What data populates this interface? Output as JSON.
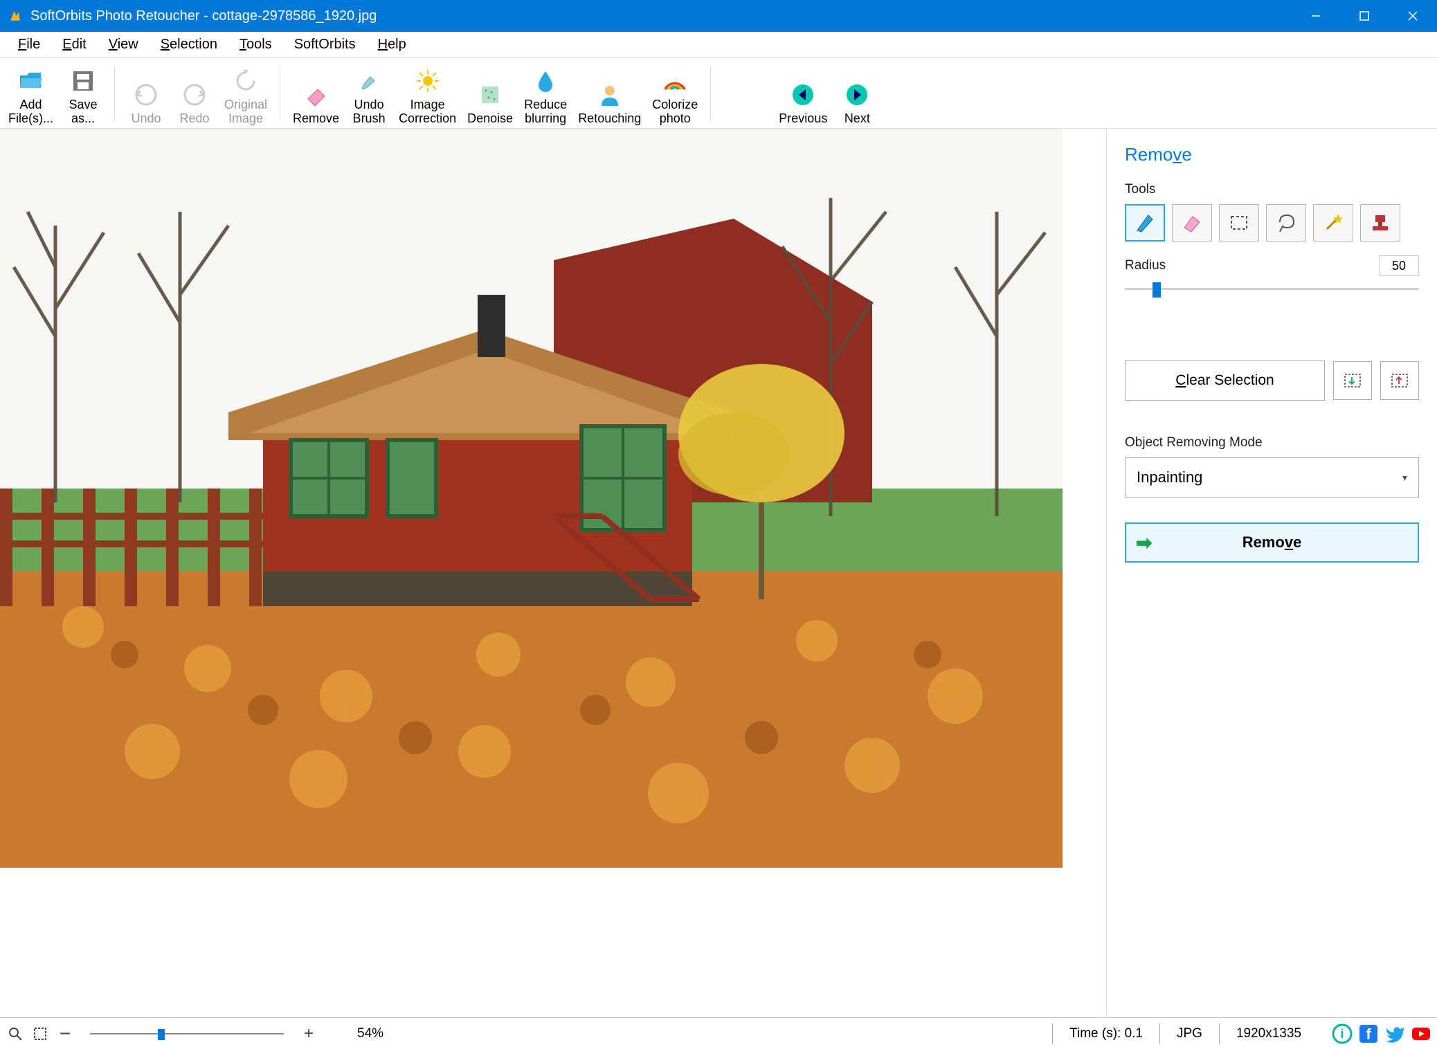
{
  "titlebar": {
    "app_name": "SoftOrbits Photo Retoucher",
    "file_name": "cottage-2978586_1920.jpg"
  },
  "menubar": [
    "File",
    "Edit",
    "View",
    "Selection",
    "Tools",
    "SoftOrbits",
    "Help"
  ],
  "toolbar": {
    "add_files": "Add File(s)...",
    "save_as": "Save as...",
    "undo": "Undo",
    "redo": "Redo",
    "original": "Original Image",
    "remove": "Remove",
    "undo_brush": "Undo Brush",
    "image_correction": "Image Correction",
    "denoise": "Denoise",
    "reduce_blur": "Reduce blurring",
    "retouching": "Retouching",
    "colorize": "Colorize photo",
    "previous": "Previous",
    "next": "Next"
  },
  "side": {
    "title": "Remove",
    "tools_label": "Tools",
    "tool_icons": [
      "marker",
      "eraser",
      "rect-select",
      "lasso",
      "magic-wand",
      "stamp"
    ],
    "radius_label": "Radius",
    "radius_value": "50",
    "clear_selection": "Clear Selection",
    "mode_label": "Object Removing Mode",
    "mode_value": "Inpainting",
    "remove_button": "Remove"
  },
  "statusbar": {
    "zoom": "54%",
    "time": "Time (s): 0.1",
    "format": "JPG",
    "dims": "1920x1335"
  },
  "colors": {
    "accent": "#0078d7",
    "teal": "#00b3a1"
  }
}
